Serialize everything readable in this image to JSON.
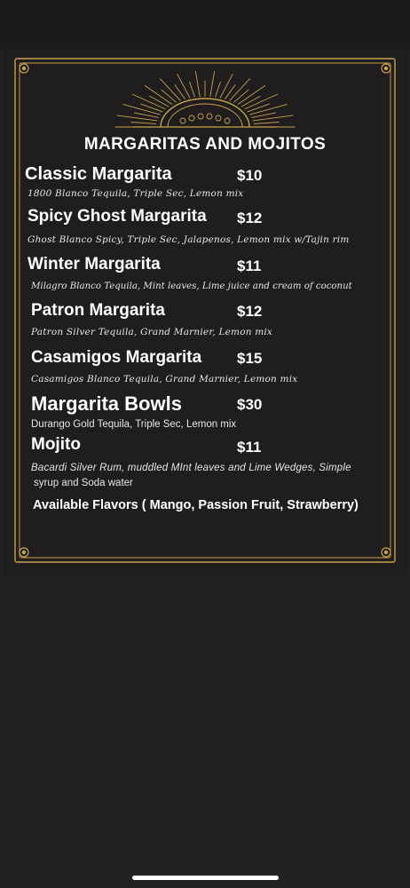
{
  "menu": {
    "title": "MARGARITAS AND MOJITOS",
    "items": [
      {
        "name": "Classic Margarita",
        "price": "$10",
        "description": "1800 Blanco Tequila, Triple Sec, Lemon mix"
      },
      {
        "name": "Spicy Ghost Margarita",
        "price": "$12",
        "description": "Ghost Blanco Spicy, Triple Sec, Jalapenos, Lemon mix w/Tajin rim"
      },
      {
        "name": "Winter Margarita",
        "price": "$11",
        "description": "Milagro Blanco Tequila, Mint leaves, Lime juice and cream of coconut"
      },
      {
        "name": "Patron Margarita",
        "price": "$12",
        "description": "Patron Silver Tequila, Grand Marnier, Lemon mix"
      },
      {
        "name": "Casamigos Margarita",
        "price": "$15",
        "description": "Casamigos Blanco Tequila, Grand Marnier, Lemon mix"
      },
      {
        "name": "Margarita Bowls",
        "price": "$30",
        "description": "Durango Gold Tequila, Triple Sec, Lemon mix"
      },
      {
        "name": "Mojito",
        "price": "$11",
        "description_line1": "Bacardi Silver Rum, muddled MInt leaves and Lime Wedges, Simple",
        "description_line2": "syrup and Soda water"
      }
    ],
    "flavors": "Available Flavors ( Mango, Passion Fruit, Strawberry)"
  },
  "colors": {
    "gold": "#c9a24a",
    "card_background": "#1f1d1e",
    "page_background": "#222122",
    "text": "#ffffff"
  }
}
